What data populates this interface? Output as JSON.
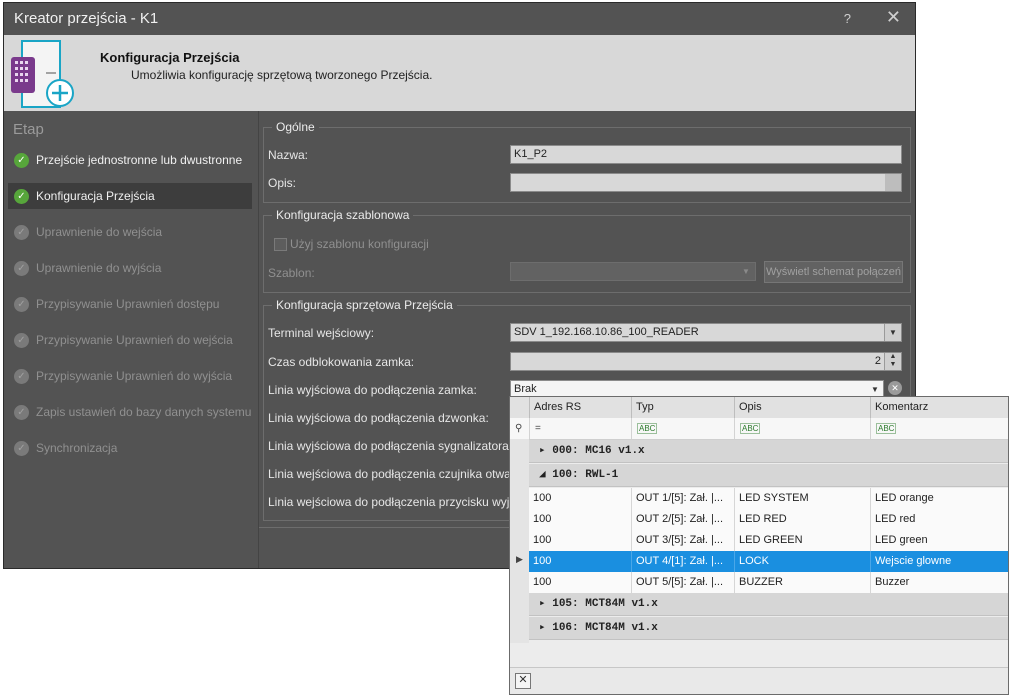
{
  "window": {
    "title": "Kreator przejścia - K1",
    "help": "?",
    "close": "✕"
  },
  "header": {
    "title": "Konfiguracja Przejścia",
    "subtitle": "Umożliwia konfigurację sprzętową tworzonego Przejścia."
  },
  "sidebar": {
    "heading": "Etap",
    "steps": [
      {
        "label": "Przejście jednostronne lub dwustronne"
      },
      {
        "label": "Konfiguracja Przejścia"
      },
      {
        "label": "Uprawnienie do wejścia"
      },
      {
        "label": "Uprawnienie do wyjścia"
      },
      {
        "label": "Przypisywanie Uprawnień dostępu"
      },
      {
        "label": "Przypisywanie Uprawnień do wejścia"
      },
      {
        "label": "Przypisywanie Uprawnień do wyjścia"
      },
      {
        "label": "Zapis ustawień do bazy danych systemu"
      },
      {
        "label": "Synchronizacja"
      }
    ]
  },
  "general": {
    "legend": "Ogólne",
    "name_label": "Nazwa:",
    "name_value": "K1_P2",
    "desc_label": "Opis:",
    "desc_value": ""
  },
  "template": {
    "legend": "Konfiguracja szablonowa",
    "use_template_label": "Użyj szablonu konfiguracji",
    "template_label": "Szablon:",
    "template_value": "",
    "show_schema_button": "Wyświetl schemat połączeń"
  },
  "hardware": {
    "legend": "Konfiguracja sprzętowa Przejścia",
    "terminal_label": "Terminal wejściowy:",
    "terminal_value": "SDV 1_192.168.10.86_100_READER",
    "unlock_time_label": "Czas odblokowania zamka:",
    "unlock_time_value": "2",
    "lock_line_label": "Linia wyjściowa do podłączenia zamka:",
    "lock_line_value": "Brak",
    "bell_line_label": "Linia wyjściowa do podłączenia dzwonka:",
    "signal_line_label": "Linia wyjściowa do podłączenia sygnalizatora:",
    "sensor_line_label": "Linia wejściowa do podłączenia czujnika otwarcia:",
    "button_line_label": "Linia wejściowa do podłączenia przycisku wyjścia:"
  },
  "popup": {
    "columns": [
      "Adres RS",
      "Typ",
      "Opis",
      "Komentarz"
    ],
    "filter_eq": "=",
    "filter_abc": "ABC",
    "groups": [
      {
        "label": "000: MC16 v1.x"
      },
      {
        "label": "100: RWL-1"
      },
      {
        "label": "105: MCT84M v1.x"
      },
      {
        "label": "106: MCT84M v1.x"
      }
    ],
    "rows": [
      {
        "adres": "100",
        "typ": "OUT 1/[5]: Zał. |...",
        "opis": "LED SYSTEM",
        "komentarz": "LED orange"
      },
      {
        "adres": "100",
        "typ": "OUT 2/[5]: Zał. |...",
        "opis": "LED RED",
        "komentarz": "LED red"
      },
      {
        "adres": "100",
        "typ": "OUT 3/[5]: Zał. |...",
        "opis": "LED GREEN",
        "komentarz": "LED green"
      },
      {
        "adres": "100",
        "typ": "OUT 4/[1]: Zał. |...",
        "opis": "LOCK",
        "komentarz": "Wejscie glowne"
      },
      {
        "adres": "100",
        "typ": "OUT 5/[5]: Zał. |...",
        "opis": "BUZZER",
        "komentarz": "Buzzer"
      }
    ],
    "close": "✕"
  }
}
